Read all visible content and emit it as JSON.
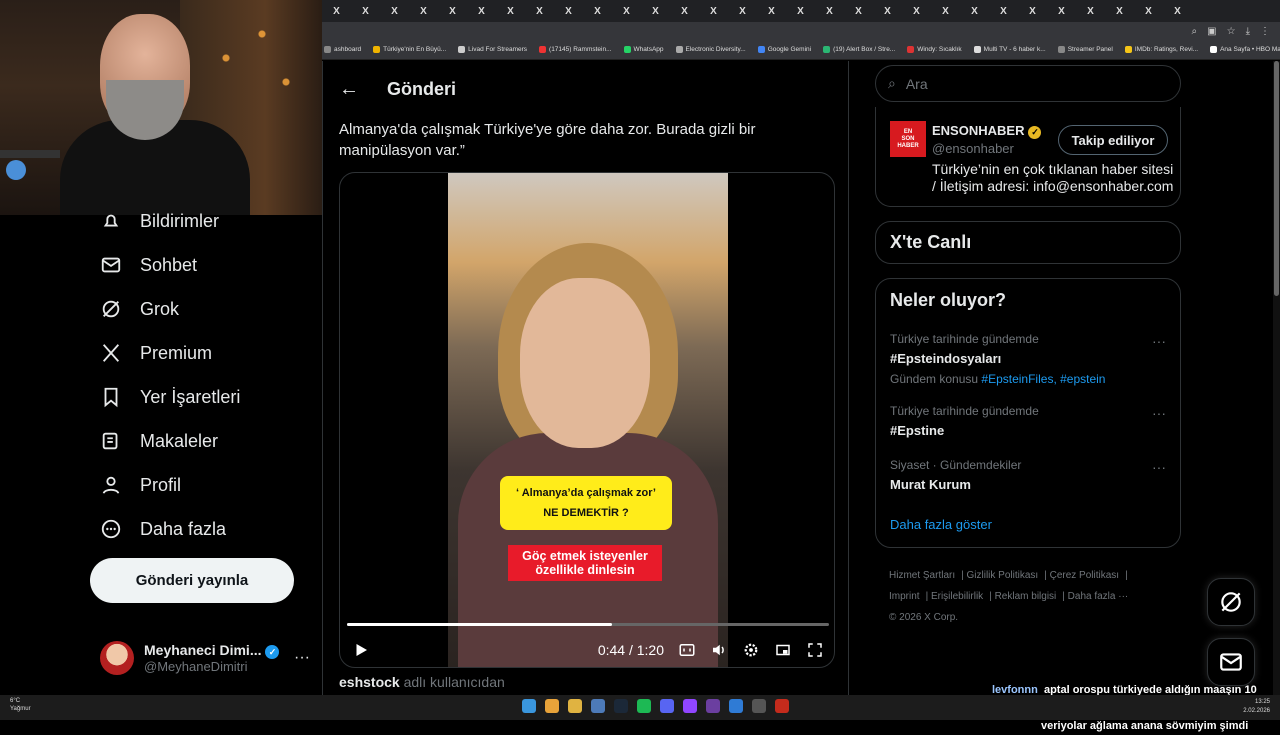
{
  "browser": {
    "tabs": [
      "X",
      "X",
      "X",
      "X",
      "X",
      "X",
      "X",
      "X",
      "X",
      "X",
      "X",
      "X",
      "X",
      "X",
      "X",
      "X",
      "X",
      "X",
      "X",
      "X",
      "X",
      "X",
      "X",
      "X",
      "X",
      "X",
      "X",
      "X",
      "X",
      "X"
    ],
    "bookmarks": [
      "ashboard",
      "Türkiye'nin En Büyü...",
      "Livad For Streamers",
      "(17145) Rammstein...",
      "WhatsApp",
      "Electronic Diversity...",
      "Google Gemini",
      "(19) Alert Box / Stre...",
      "Windy: Sıcaklık",
      "Multi TV - 6 haber k...",
      "Streamer Panel",
      "IMDb: Ratings, Revi...",
      "Ana Sayfa • HBO Max",
      "Tüm Yer İşaretleri"
    ]
  },
  "nav": {
    "items": [
      "Bildirimler",
      "Sohbet",
      "Grok",
      "Premium",
      "Yer İşaretleri",
      "Makaleler",
      "Profil",
      "Daha fazla"
    ],
    "post_button": "Gönderi yayınla"
  },
  "profile": {
    "name": "Meyhaneci Dimi...",
    "handle": "@MeyhaneDimitri"
  },
  "main": {
    "title": "Gönderi",
    "tweet_text": "Almanya'da çalışmak Türkiye'ye göre daha zor. Burada gizli bir manipülasyon var.”",
    "video": {
      "caption1_line1": "‘ Almanya’da çalışmak zor’",
      "caption1_line2": "NE DEMEKTİR ?",
      "caption2_line1": "Göç etmek isteyenler",
      "caption2_line2": "özellikle dinlesin",
      "time": "0:44 / 1:20",
      "progress": 0.55
    },
    "attribution_user": "eshstock",
    "attribution_rest": "adlı kullanıcıdan"
  },
  "right": {
    "search_placeholder": "Ara",
    "account": {
      "logo_lines": [
        "EN",
        "SON",
        "HABER"
      ],
      "name": "ENSONHABER",
      "handle": "@ensonhaber",
      "follow_label": "Takip ediliyor",
      "bio": "Türkiye’nin en çok tıklanan haber sitesi / İletişim adresi: info@ensonhaber.com"
    },
    "live_title": "X'te Canlı",
    "trends_title": "Neler oluyor?",
    "trends": [
      {
        "context": "Türkiye tarihinde gündemde",
        "name": "#Epsteindosyaları",
        "sub_prefix": "Gündem konusu",
        "sub_links": "#EpsteinFiles, #epstein"
      },
      {
        "context": "Türkiye tarihinde gündemde",
        "name": "#Epstine"
      },
      {
        "context": "Siyaset · Gündemdekiler",
        "name": "Murat Kurum"
      }
    ],
    "show_more": "Daha fazla göster",
    "footer": [
      "Hizmet Şartları",
      "Gizlilik Politikası",
      "Çerez Politikası",
      "Imprint",
      "Erişilebilirlik",
      "Reklam bilgisi",
      "Daha fazla ···",
      "© 2026 X Corp."
    ]
  },
  "chat": {
    "user": "levfonnn",
    "line1": "aptal orospu türkiyede aldığın maaşın 10 katını",
    "line2": "veriyolar ağlama anana sövmiyim şimdi"
  },
  "taskbar": {
    "weather_temp": "6°C",
    "weather_desc": "Yağmur",
    "time": "13:25",
    "date": "2.02.2026"
  },
  "colors": {
    "accent": "#1d9bf0",
    "bg": "#000000",
    "border": "#2f3336",
    "muted": "#71767b"
  }
}
